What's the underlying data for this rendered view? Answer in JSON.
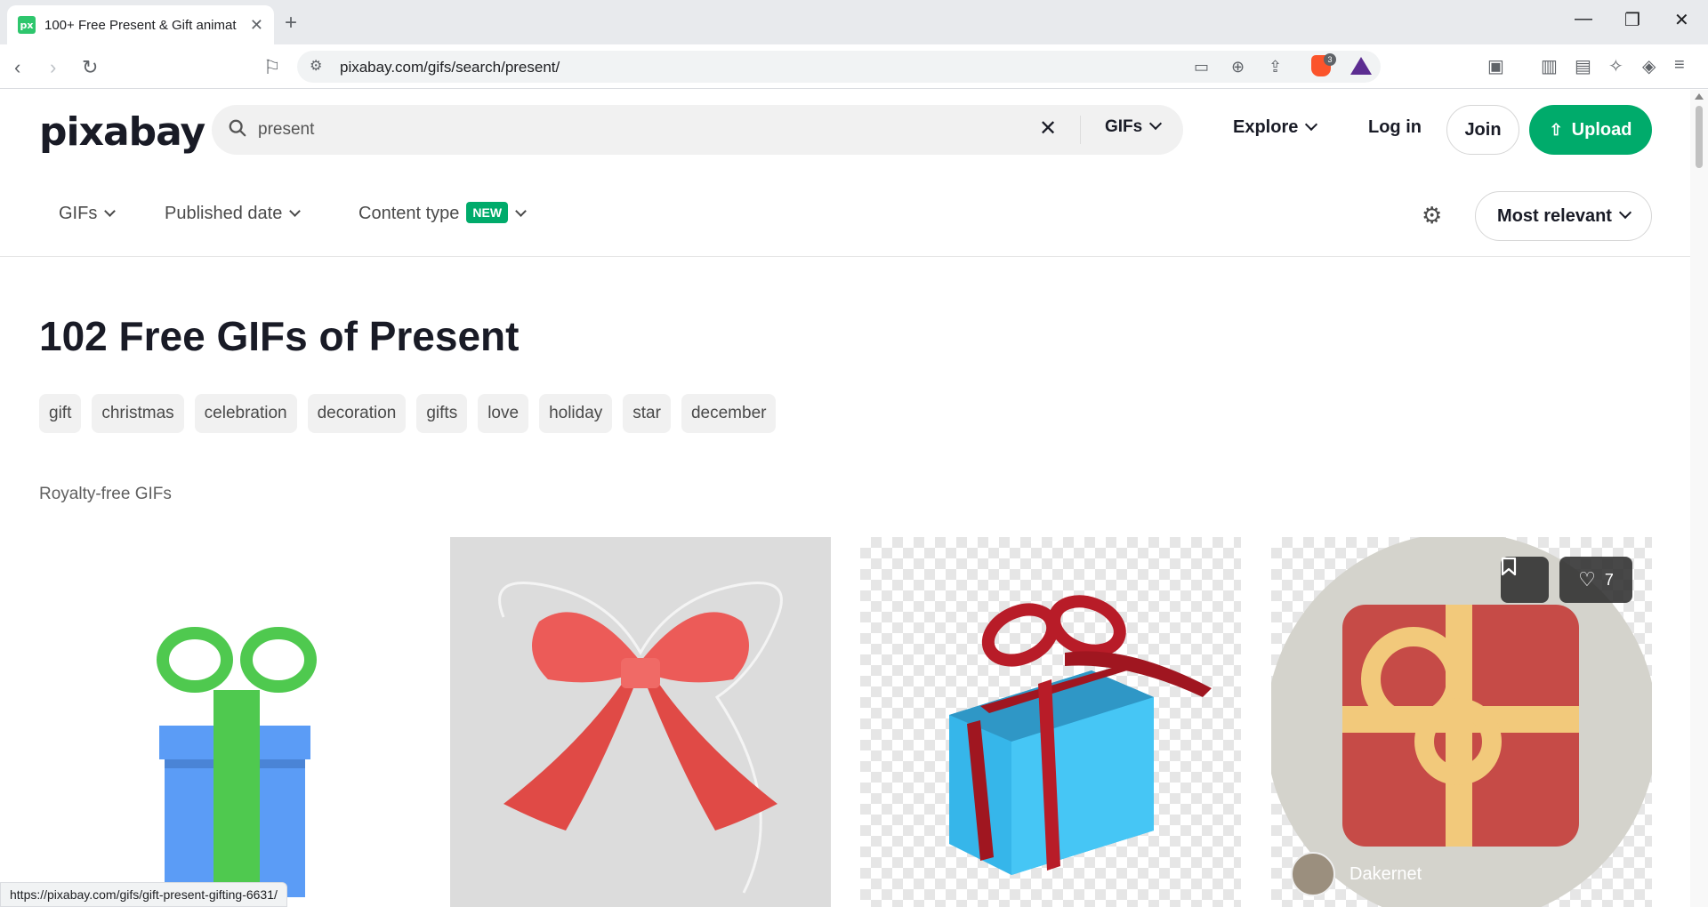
{
  "browser": {
    "tab_title": "100+ Free Present & Gift animat",
    "favicon_text": "px",
    "url": "pixabay.com/gifs/search/present/",
    "brave_count": "3",
    "status_url": "https://pixabay.com/gifs/gift-present-gifting-6631/"
  },
  "header": {
    "logo": "pixabay",
    "search_value": "present",
    "search_type": "GIFs",
    "explore": "Explore",
    "login": "Log in",
    "join": "Join",
    "upload": "Upload"
  },
  "filters": {
    "media": "GIFs",
    "published": "Published date",
    "content_type": "Content type",
    "new_badge": "NEW",
    "sort": "Most relevant"
  },
  "main": {
    "heading": "102 Free GIFs of Present",
    "tags": [
      "gift",
      "christmas",
      "celebration",
      "decoration",
      "gifts",
      "love",
      "holiday",
      "star",
      "december"
    ],
    "subheading": "Royalty-free GIFs",
    "cards": [
      {
        "likes": "7",
        "author": "Dakernet"
      }
    ]
  },
  "colors": {
    "brand": "#00ab6b",
    "text": "#191b26"
  }
}
